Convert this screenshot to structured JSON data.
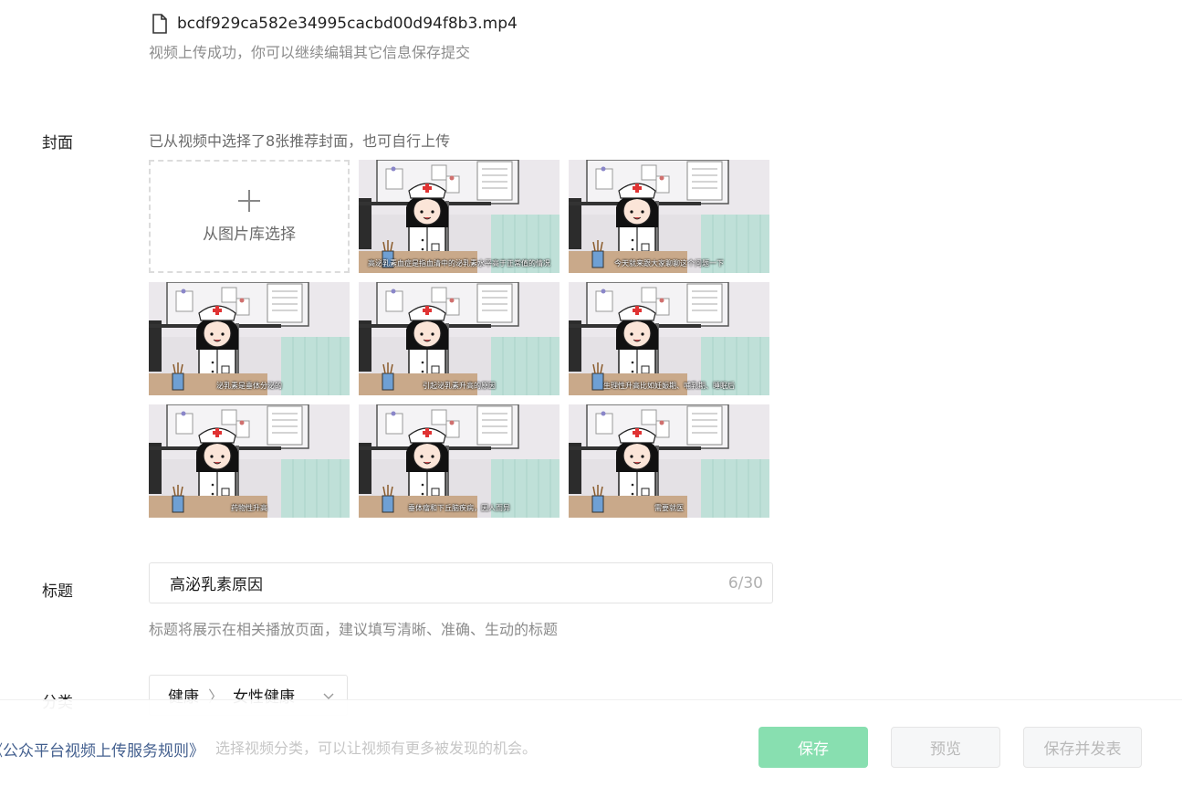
{
  "file": {
    "icon": "file-icon",
    "name": "bcdf929ca582e34995cacbd00d94f8b3.mp4",
    "status": "视频上传成功，你可以继续编辑其它信息保存提交"
  },
  "cover": {
    "label": "封面",
    "hint": "已从视频中选择了8张推荐封面，也可自行上传",
    "upload_label": "从图片库选择",
    "thumbnails": [
      {
        "caption": "高泌乳素血症是指血清中的泌乳素水平高于正常值的情况"
      },
      {
        "caption": "今天就来跟大家聊聊这个问题一下"
      },
      {
        "caption": "泌乳素是垂体分泌的"
      },
      {
        "caption": "引起泌乳素升高的原因"
      },
      {
        "caption": "生理性升高比如妊娠期、哺乳期、睡眠后"
      },
      {
        "caption": "药物性升高"
      },
      {
        "caption": "垂体瘤和下丘脑疾病，因人而异"
      },
      {
        "caption": "需要就医"
      }
    ]
  },
  "title": {
    "label": "标题",
    "value": "高泌乳素原因",
    "count": "6/30",
    "hint": "标题将展示在相关播放页面，建议填写清晰、准确、生动的标题"
  },
  "category": {
    "label": "分类",
    "primary": "健康",
    "separator": "〉",
    "secondary": "女性健康",
    "hint": "选择视频分类，可以让视频有更多被发现的机会。"
  },
  "footer": {
    "rules_link": "《公众平台视频上传服务规则》",
    "save_label": "保存",
    "preview_label": "预览",
    "publish_label": "保存并发表"
  },
  "colors": {
    "primary_green": "#88dfb0",
    "link_blue": "#44608f",
    "hint_gray": "#8c8c8c"
  }
}
